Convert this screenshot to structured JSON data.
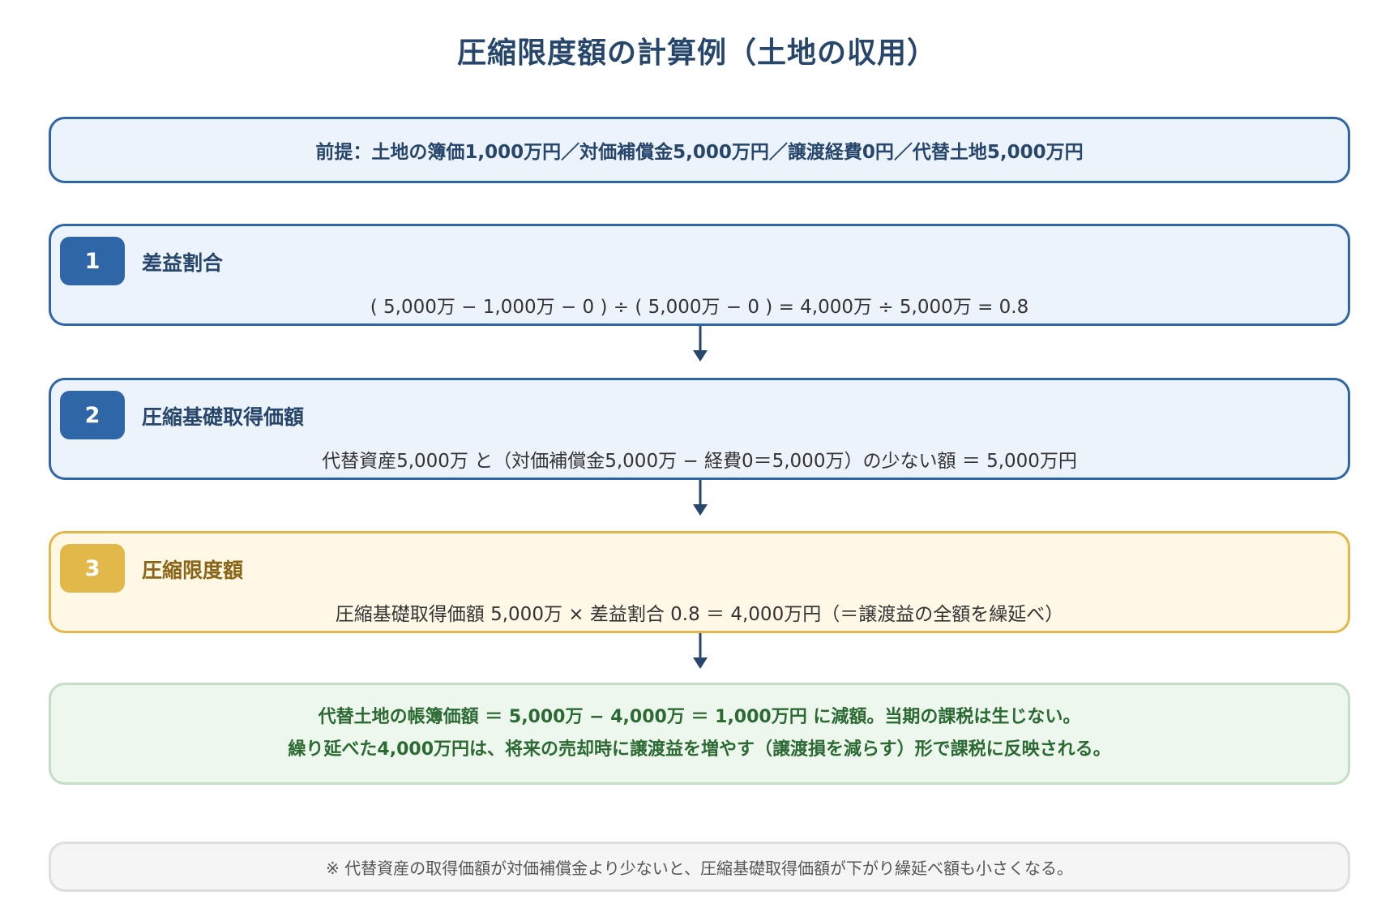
{
  "title": "圧縮限度額の計算例（土地の収用）",
  "premise": "前提：土地の簿価1,000万円／対価補償金5,000万円／譲渡経費0円／代替土地5,000万円",
  "steps": [
    {
      "number": "1",
      "label": "差益割合",
      "formula": "( 5,000万 − 1,000万 − 0 ) ÷ ( 5,000万 − 0 ) = 4,000万 ÷ 5,000万 = 0.8"
    },
    {
      "number": "2",
      "label": "圧縮基礎取得価額",
      "formula": "代替資産5,000万 と（対価補償金5,000万 − 経費0＝5,000万）の少ない額 ＝ 5,000万円"
    },
    {
      "number": "3",
      "label": "圧縮限度額",
      "formula": "圧縮基礎取得価額 5,000万 × 差益割合 0.8 ＝ 4,000万円（＝譲渡益の全額を繰延べ）"
    }
  ],
  "result": {
    "line1": "代替土地の帳簿価額 ＝ 5,000万 − 4,000万 ＝ 1,000万円 に減額。当期の課税は生じない。",
    "line2": "繰り延べた4,000万円は、将来の売却時に譲渡益を増やす（譲渡損を減らす）形で課税に反映される。"
  },
  "note": "※ 代替資産の取得価額が対価補償金より少ないと、圧縮基礎取得価額が下がり繰延べ額も小さくなる。",
  "colors": {
    "title": "#27466b",
    "step_border": "#2f66a8",
    "step_bg": "#edf3fb",
    "gold_border": "#e3b84a",
    "gold_bg": "#fff8e6",
    "result_border": "#c3dec5",
    "result_bg": "#eef7ee",
    "result_text": "#2c6a33",
    "note_border": "#dedede",
    "note_bg": "#f5f5f5",
    "arrow": "#27466b"
  }
}
